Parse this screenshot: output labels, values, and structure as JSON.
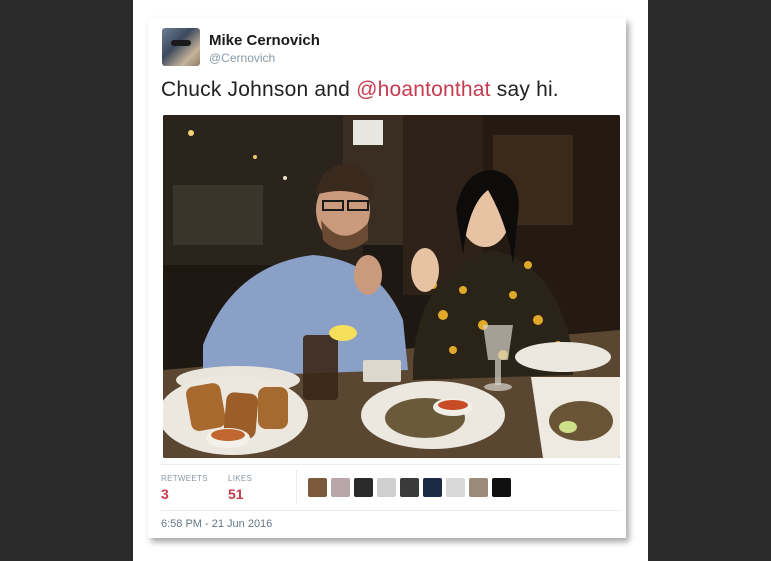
{
  "tweet": {
    "display_name": "Mike Cernovich",
    "handle": "@Cernovich",
    "text_before": "Chuck Johnson and ",
    "mention": "@hoantonthat",
    "text_after": " say hi.",
    "retweets_label": "RETWEETS",
    "retweets_count": "3",
    "likes_label": "LIKES",
    "likes_count": "51",
    "timestamp": "6:58 PM - 21 Jun 2016"
  },
  "colors": {
    "mention": "#c63b4e",
    "count": "#c63b4e"
  },
  "likers": [
    {
      "name": "liker-avatar-1",
      "color": "#7a5a3a"
    },
    {
      "name": "liker-avatar-2",
      "color": "#b7a5a8"
    },
    {
      "name": "liker-avatar-3",
      "color": "#2a2a2a"
    },
    {
      "name": "liker-avatar-4",
      "color": "#cfcfcf"
    },
    {
      "name": "liker-avatar-5",
      "color": "#3a3a3a"
    },
    {
      "name": "liker-avatar-6",
      "color": "#1c2a48"
    },
    {
      "name": "liker-avatar-7",
      "color": "#d8d8d8"
    },
    {
      "name": "liker-avatar-8",
      "color": "#9a8a7a"
    },
    {
      "name": "liker-avatar-9",
      "color": "#101010"
    }
  ]
}
